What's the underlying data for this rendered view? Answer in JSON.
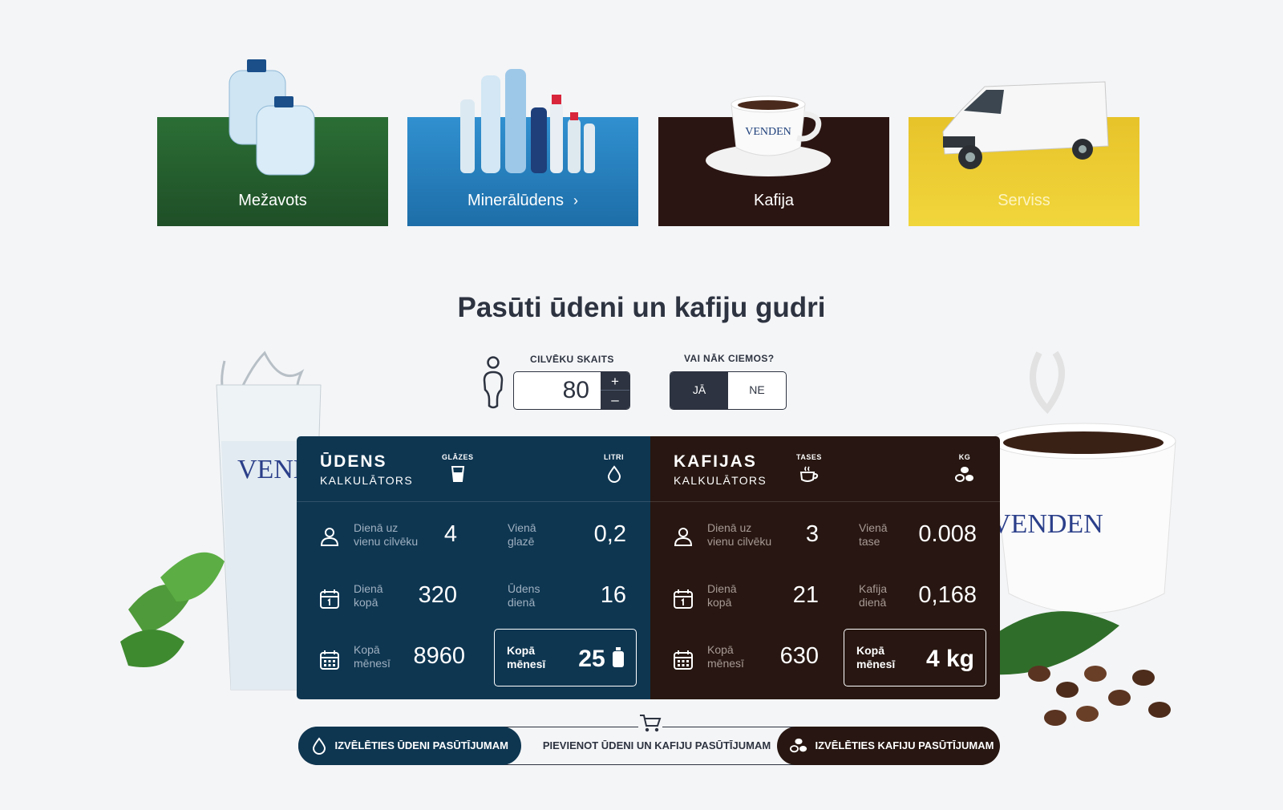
{
  "categories": [
    {
      "label": "Mežavots"
    },
    {
      "label": "Minerālūdens",
      "chevron": "›"
    },
    {
      "label": "Kafija"
    },
    {
      "label": "Serviss"
    }
  ],
  "decor_text": {
    "venden": "VENDEN"
  },
  "heading": "Pasūti ūdeni un kafiju gudri",
  "people": {
    "label": "CILVĒKU SKAITS",
    "value": "80",
    "plus": "+",
    "minus": "–"
  },
  "guests": {
    "label": "VAI NĀK CIEMOS?",
    "yes": "JĀ",
    "no": "NE",
    "selected": "JĀ"
  },
  "water": {
    "title": "ŪDENS",
    "subtitle": "KALKULĀTORS",
    "col1": "GLĀZES",
    "col2": "LITRI",
    "rows": [
      {
        "label1": "Dienā uz",
        "label2": "vienu cilvēku",
        "value": "4",
        "rlabel1": "Vienā",
        "rlabel2": "glazē",
        "rvalue": "0,2"
      },
      {
        "label1": "Dienā",
        "label2": "kopā",
        "value": "320",
        "rlabel1": "Ūdens",
        "rlabel2": "dienā",
        "rvalue": "16"
      },
      {
        "label1": "Kopā",
        "label2": "mēnesī",
        "value": "8960"
      }
    ],
    "total": {
      "label1": "Kopā",
      "label2": "mēnesī",
      "value": "25"
    }
  },
  "coffee": {
    "title": "KAFIJAS",
    "subtitle": "KALKULĀTORS",
    "col1": "TASES",
    "col2": "KG",
    "rows": [
      {
        "label1": "Dienā uz",
        "label2": "vienu cilvēku",
        "value": "3",
        "rlabel1": "Vienā",
        "rlabel2": "tase",
        "rvalue": "0.008"
      },
      {
        "label1": "Dienā",
        "label2": "kopā",
        "value": "21",
        "rlabel1": "Kafija",
        "rlabel2": "dienā",
        "rvalue": "0,168"
      },
      {
        "label1": "Kopā",
        "label2": "mēnesī",
        "value": "630"
      }
    ],
    "total": {
      "label1": "Kopā",
      "label2": "mēnesī",
      "value": "4 kg"
    }
  },
  "actions": {
    "water": "IZVĒLĒTIES ŪDENI PASŪTĪJUMAM",
    "both": "PIEVIENOT ŪDENI UN KAFIJU PASŪTĪJUMAM",
    "coffee": "IZVĒLĒTIES KAFIJU PASŪTĪJUMAM"
  },
  "colors": {
    "water_panel": "#0e3651",
    "coffee_panel": "#271611",
    "mezavots": "#1f4f27",
    "mineral": "#1d6ea8",
    "kafija": "#2b1512",
    "serviss": "#e7c32a",
    "text": "#2d3340"
  }
}
